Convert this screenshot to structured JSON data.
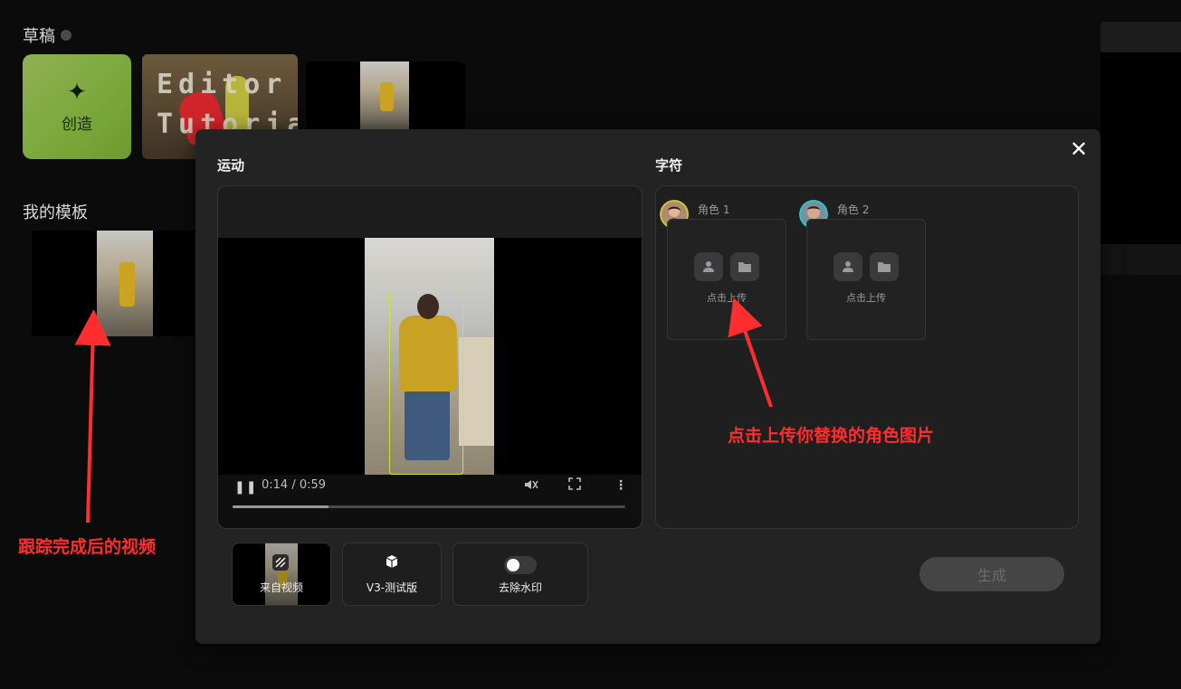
{
  "background": {
    "drafts_title": "草稿",
    "create_label": "创造",
    "tutorial_text": "Editor Tutorial",
    "templates_title": "我的模板"
  },
  "modal": {
    "close_icon": "close-icon",
    "motion_title": "运动",
    "characters_title": "字符",
    "video": {
      "time": "0:14 / 0:59",
      "progress_fraction": 0.245
    },
    "characters": [
      {
        "name": "角色 1",
        "upload_text": "点击上传",
        "ring_color": "#c9c83d"
      },
      {
        "name": "角色 2",
        "upload_text": "点击上传",
        "ring_color": "#2fc4c4"
      }
    ],
    "options": {
      "from_video": "来自视频",
      "version": "V3-测试版",
      "watermark": "去除水印"
    },
    "generate_label": "生成"
  },
  "annotations": {
    "left_text": "跟踪完成后的视频",
    "right_text": "点击上传你替换的角色图片"
  }
}
